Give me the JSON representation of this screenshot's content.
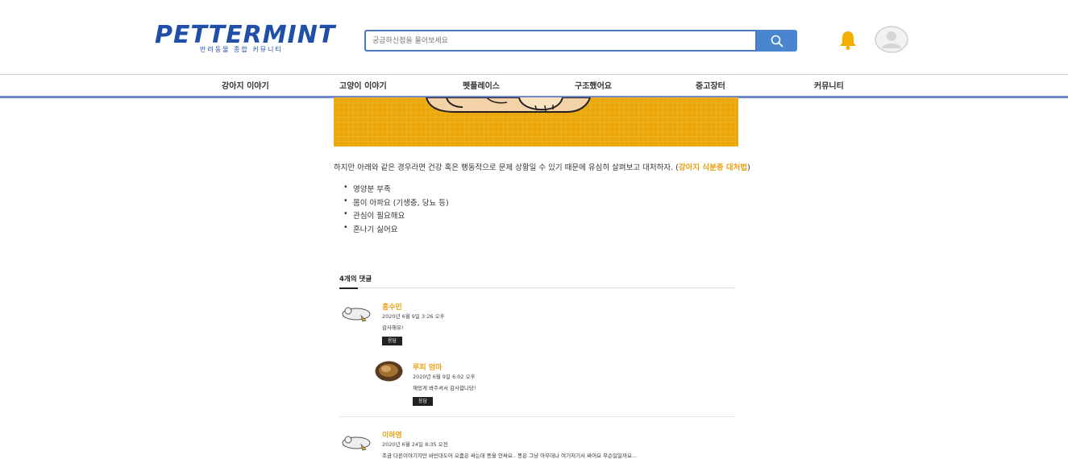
{
  "header": {
    "logo_text": "PETTERMINT",
    "logo_subtitle": "반려동물 종합 커뮤니티",
    "search_placeholder": "궁금하신점을 물어보세요"
  },
  "nav": {
    "items": [
      {
        "label": "강아지 이야기"
      },
      {
        "label": "고양이 이야기"
      },
      {
        "label": "펫플레이스"
      },
      {
        "label": "구조했어요"
      },
      {
        "label": "중고장터"
      },
      {
        "label": "커뮤니티"
      }
    ]
  },
  "article": {
    "paragraph": "하지만 아래와 같은 경우라면 건강 혹은 행동적으로 문제 상황일 수 있기 때문에 유심히 살펴보고 대처하자. (",
    "link_text": "강아지 식분증 대처법",
    "paragraph_end": ")",
    "bullets": [
      "영양분 부족",
      "몸이 아파요 (기생충, 당뇨 등)",
      "관심이 필요해요",
      "혼나기 싫어요"
    ]
  },
  "comments": {
    "heading": "4개의 댓글",
    "items": [
      {
        "author": "홍수민",
        "date": "2020년 6월 9일 3:26 오후",
        "text": "감사해유!",
        "reply_label": "응답"
      },
      {
        "author": "루피 엄마",
        "date": "2020년 6월 9일 6:02 오후",
        "text": "재밌게 봐주셔서 감사합니당!",
        "reply_label": "응답"
      },
      {
        "author": "이하영",
        "date": "2020년 6월 24일 8:35 오전",
        "text": "조금 다른이야기지만 바빈대도어 오줌은 싸는데 똥을 안싸요.. 똥은 그냥 아무데나 여기저기서 싸어요 무슨일일까요..."
      }
    ]
  },
  "colors": {
    "brand_blue": "#1f4fa8",
    "accent_orange": "#e8a317",
    "banner_yellow": "#eca80a",
    "nav_underline": "#6f86c8"
  }
}
